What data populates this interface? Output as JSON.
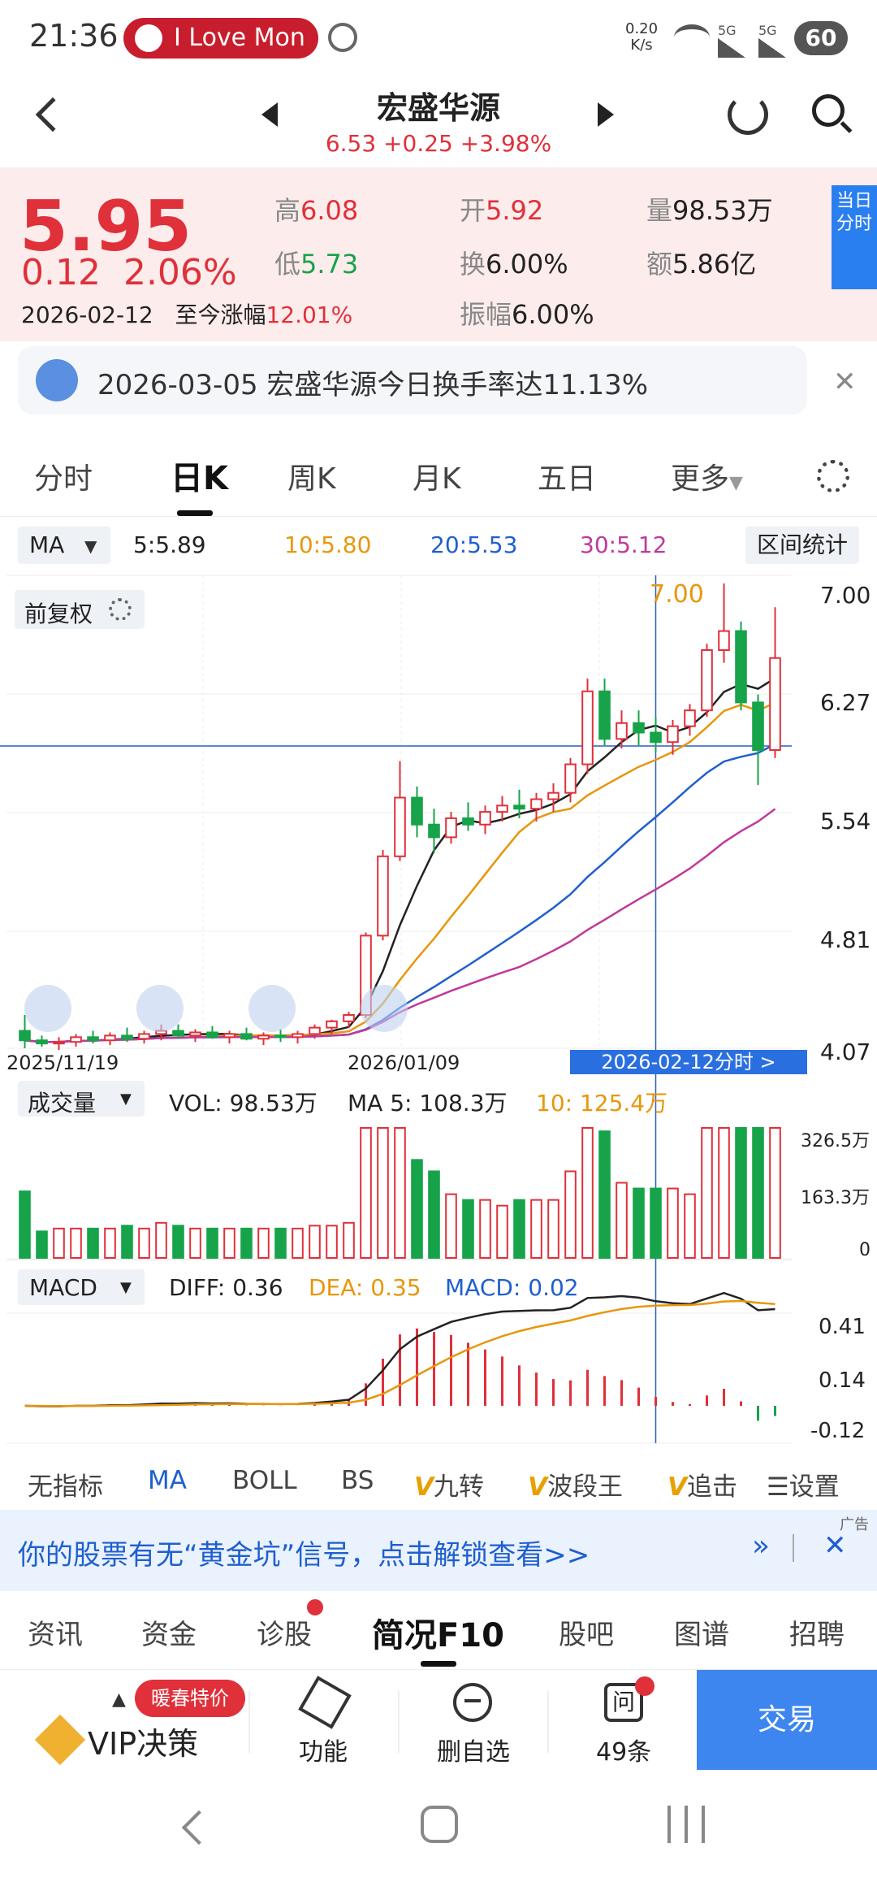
{
  "status_bar": {
    "time": "21:36",
    "notification": "I Love Mon",
    "net_speed_value": "0.20",
    "net_speed_unit": "K/s",
    "battery": "60",
    "signal1": "5G",
    "signal2": "5G"
  },
  "header": {
    "title": "宏盛华源",
    "subline": "6.53  +0.25  +3.98%"
  },
  "quote": {
    "price": "5.95",
    "change": "0.12",
    "change_pct": "2.06%",
    "date": "2026-02-12",
    "since_label": "至今涨幅",
    "since_value": "12.01%",
    "high_label": "高",
    "high": "6.08",
    "low_label": "低",
    "low": "5.73",
    "open_label": "开",
    "open": "5.92",
    "turnover_label": "换",
    "turnover": "6.00%",
    "amplitude_label": "振幅",
    "amplitude": "6.00%",
    "volume_label": "量",
    "volume": "98.53万",
    "amount_label": "额",
    "amount": "5.86亿",
    "side_button": "当日分时"
  },
  "notice": {
    "text": "2026-03-05 宏盛华源今日换手率达11.13%"
  },
  "kline_tabs": [
    "分时",
    "日K",
    "周K",
    "月K",
    "五日",
    "更多"
  ],
  "ma_legend": {
    "selector": "MA",
    "ma5": "5:5.89",
    "ma10": "10:5.80",
    "ma20": "20:5.53",
    "ma30": "30:5.12",
    "range_stats": "区间统计"
  },
  "price_chart": {
    "adjust": "前复权",
    "max_label": "7.00",
    "y_ticks": [
      "7.00",
      "6.27",
      "5.54",
      "4.81",
      "4.07"
    ],
    "x_ticks": [
      "2025/11/19",
      "2026/01/09"
    ],
    "cursor_label": "2026-02-12分时  >"
  },
  "volume_legend": {
    "selector": "成交量",
    "vol": "VOL: 98.53万",
    "ma5": "MA 5: 108.3万",
    "ma10": "10: 125.4万",
    "y_ticks": [
      "326.5万",
      "163.3万",
      "0"
    ]
  },
  "macd_legend": {
    "selector": "MACD",
    "diff": "DIFF: 0.36",
    "dea": "DEA: 0.35",
    "macd": "MACD: 0.02",
    "y_ticks": [
      "0.41",
      "0.14",
      "-0.12"
    ]
  },
  "indicator_tabs": [
    "无指标",
    "MA",
    "BOLL",
    "BS",
    "九转",
    "波段王",
    "追击",
    "设置"
  ],
  "ad": {
    "text": "你的股票有无“黄金坑”信号，点击解锁查看>>",
    "tag": "广告"
  },
  "bottom_tabs": [
    "资讯",
    "资金",
    "诊股",
    "简况F10",
    "股吧",
    "图谱",
    "招聘"
  ],
  "actions": {
    "promo": "暖春特价",
    "vip": "VIP决策",
    "func": "功能",
    "remove": "删自选",
    "ask_count": "49条",
    "trade": "交易"
  },
  "colors": {
    "up": "#e0303a",
    "down": "#17a34a",
    "ma5": "#222222",
    "ma10": "#e8960c",
    "ma20": "#1f5fcf",
    "ma30": "#c0399a",
    "accent": "#2a7ff0"
  },
  "chart_data": {
    "type": "candlestick",
    "ma": {
      "ma5": 5.89,
      "ma10": 5.8,
      "ma20": 5.53,
      "ma30": 5.12
    },
    "ylim": [
      4.07,
      7.0
    ],
    "candles_ohlc_approx": [
      [
        4.18,
        4.28,
        4.07,
        4.12
      ],
      [
        4.12,
        4.15,
        4.08,
        4.1
      ],
      [
        4.1,
        4.14,
        4.06,
        4.11
      ],
      [
        4.11,
        4.16,
        4.08,
        4.14
      ],
      [
        4.14,
        4.18,
        4.1,
        4.12
      ],
      [
        4.12,
        4.17,
        4.09,
        4.15
      ],
      [
        4.15,
        4.2,
        4.11,
        4.13
      ],
      [
        4.13,
        4.18,
        4.1,
        4.16
      ],
      [
        4.16,
        4.22,
        4.12,
        4.18
      ],
      [
        4.18,
        4.22,
        4.13,
        4.15
      ],
      [
        4.15,
        4.19,
        4.11,
        4.17
      ],
      [
        4.17,
        4.21,
        4.13,
        4.14
      ],
      [
        4.14,
        4.18,
        4.1,
        4.16
      ],
      [
        4.16,
        4.2,
        4.12,
        4.13
      ],
      [
        4.13,
        4.17,
        4.09,
        4.15
      ],
      [
        4.15,
        4.19,
        4.11,
        4.14
      ],
      [
        4.14,
        4.18,
        4.1,
        4.16
      ],
      [
        4.16,
        4.22,
        4.13,
        4.2
      ],
      [
        4.2,
        4.25,
        4.16,
        4.24
      ],
      [
        4.24,
        4.3,
        4.2,
        4.28
      ],
      [
        4.28,
        4.8,
        4.26,
        4.78
      ],
      [
        4.78,
        5.32,
        4.75,
        5.28
      ],
      [
        5.28,
        5.88,
        5.25,
        5.65
      ],
      [
        5.65,
        5.72,
        5.4,
        5.48
      ],
      [
        5.48,
        5.58,
        5.3,
        5.4
      ],
      [
        5.4,
        5.56,
        5.36,
        5.52
      ],
      [
        5.52,
        5.62,
        5.44,
        5.48
      ],
      [
        5.48,
        5.6,
        5.42,
        5.56
      ],
      [
        5.56,
        5.66,
        5.5,
        5.6
      ],
      [
        5.6,
        5.7,
        5.52,
        5.58
      ],
      [
        5.58,
        5.68,
        5.5,
        5.64
      ],
      [
        5.64,
        5.74,
        5.56,
        5.68
      ],
      [
        5.68,
        5.9,
        5.62,
        5.86
      ],
      [
        5.86,
        6.4,
        5.8,
        6.32
      ],
      [
        6.32,
        6.4,
        5.98,
        6.02
      ],
      [
        6.02,
        6.2,
        5.96,
        6.12
      ],
      [
        6.12,
        6.2,
        5.98,
        6.06
      ],
      [
        6.06,
        6.16,
        5.94,
        6.0
      ],
      [
        6.0,
        6.14,
        5.92,
        6.1
      ],
      [
        6.1,
        6.24,
        6.04,
        6.2
      ],
      [
        6.2,
        6.62,
        6.16,
        6.58
      ],
      [
        6.58,
        7.0,
        6.5,
        6.7
      ],
      [
        6.7,
        6.76,
        6.2,
        6.25
      ],
      [
        6.25,
        6.3,
        5.73,
        5.95
      ],
      [
        5.95,
        6.85,
        5.9,
        6.53
      ]
    ]
  }
}
